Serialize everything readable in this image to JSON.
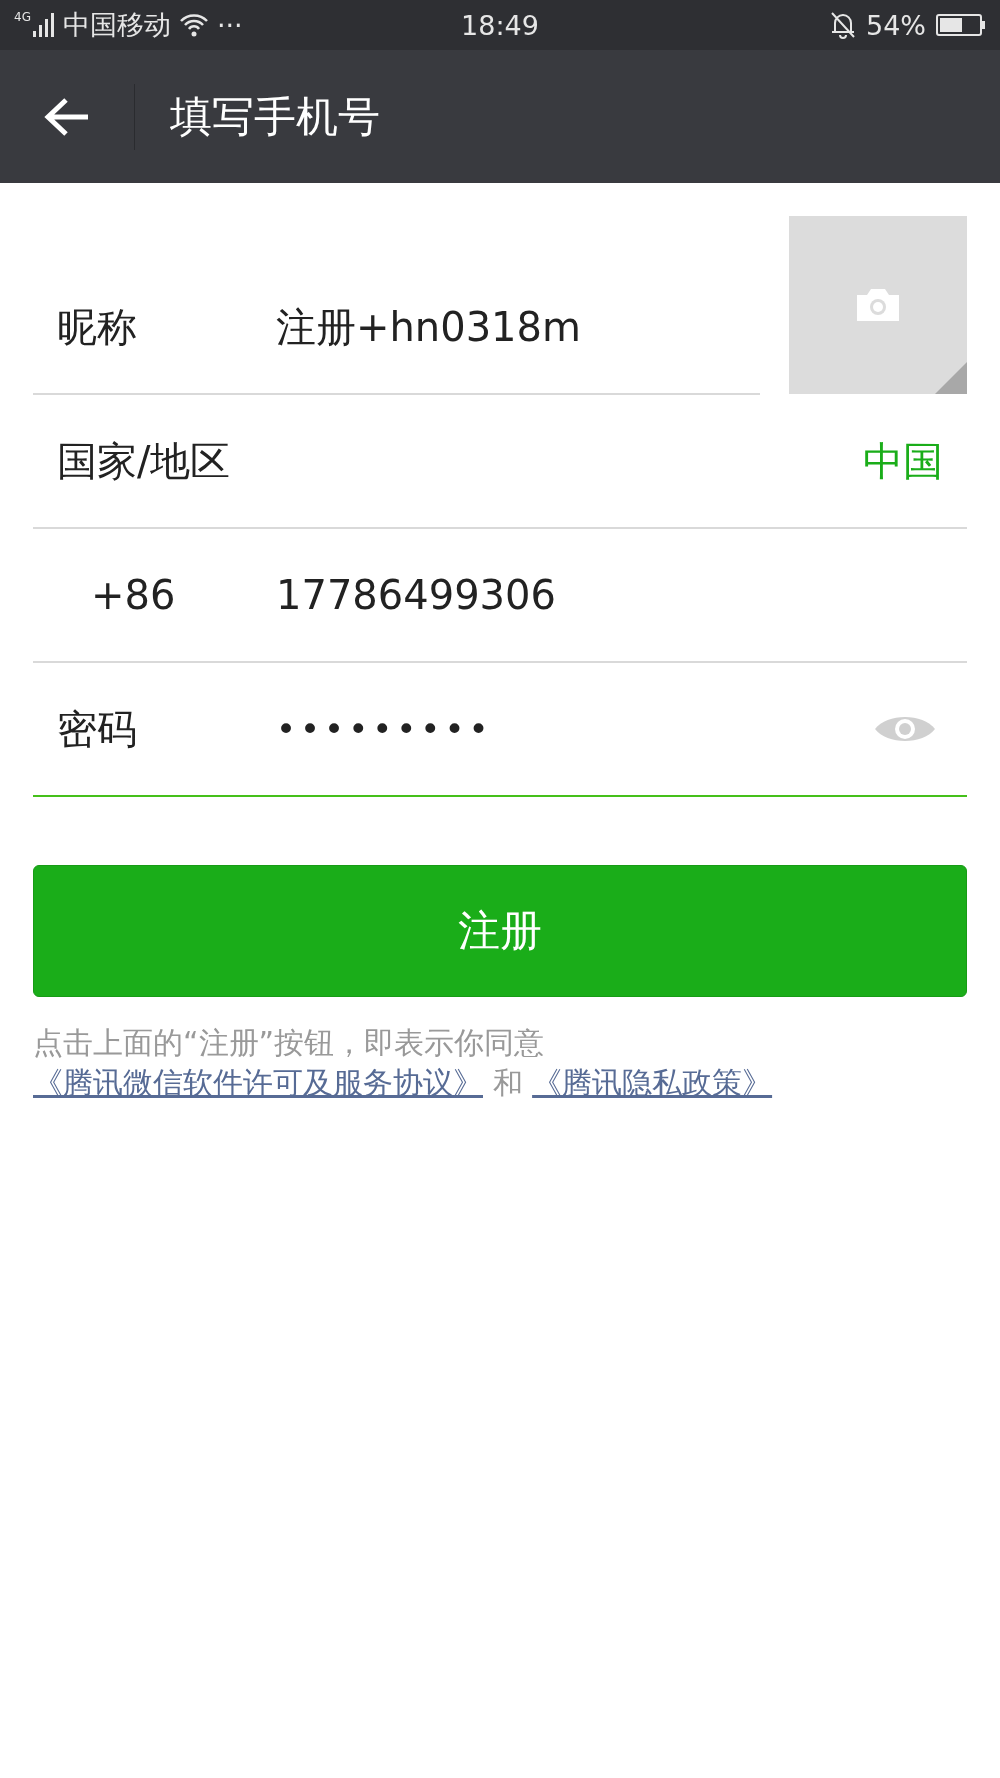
{
  "status_bar": {
    "network": "4G",
    "carrier": "中国移动",
    "more": "···",
    "time": "18:49",
    "battery": "54%"
  },
  "header": {
    "title": "填写手机号"
  },
  "form": {
    "nickname": {
      "label": "昵称",
      "value": "注册+hn0318m"
    },
    "region": {
      "label": "国家/地区",
      "value": "中国"
    },
    "phone": {
      "code": "+86",
      "value": "17786499306"
    },
    "password": {
      "label": "密码",
      "value": "•••••••••",
      "focused": true
    }
  },
  "register_button": "注册",
  "terms": {
    "text": "点击上面的“注册”按钮，即表示你同意",
    "link_1": "《腾讯微信软件许可及服务协议》",
    "joiner": "和",
    "link_2": "《腾讯隐私政策》"
  }
}
